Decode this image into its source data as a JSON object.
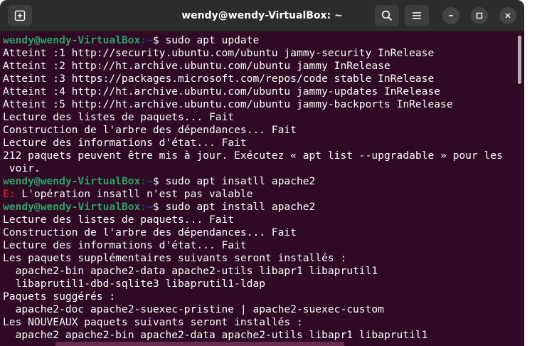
{
  "window": {
    "title": "wendy@wendy-VirtualBox: ~"
  },
  "prompt": {
    "user_host": "wendy@wendy-VirtualBox",
    "separator": ":",
    "path": "~",
    "symbol": "$ "
  },
  "lines": [
    {
      "type": "cmd",
      "text": "sudo apt update"
    },
    {
      "type": "out",
      "text": "Atteint :1 http://security.ubuntu.com/ubuntu jammy-security InRelease"
    },
    {
      "type": "out",
      "text": "Atteint :2 http://ht.archive.ubuntu.com/ubuntu jammy InRelease"
    },
    {
      "type": "out",
      "text": "Atteint :3 https://packages.microsoft.com/repos/code stable InRelease"
    },
    {
      "type": "out",
      "text": "Atteint :4 http://ht.archive.ubuntu.com/ubuntu jammy-updates InRelease"
    },
    {
      "type": "out",
      "text": "Atteint :5 http://ht.archive.ubuntu.com/ubuntu jammy-backports InRelease"
    },
    {
      "type": "out",
      "text": "Lecture des listes de paquets... Fait"
    },
    {
      "type": "out",
      "text": "Construction de l'arbre des dépendances... Fait"
    },
    {
      "type": "out",
      "text": "Lecture des informations d'état... Fait"
    },
    {
      "type": "out",
      "text": "212 paquets peuvent être mis à jour. Exécutez « apt list --upgradable » pour les"
    },
    {
      "type": "out",
      "text": " voir."
    },
    {
      "type": "cmd",
      "text": "sudo apt insatll apache2"
    },
    {
      "type": "err",
      "prefix": "E:",
      "text": " L'opération insatll n'est pas valable"
    },
    {
      "type": "cmd",
      "text": "sudo apt install apache2"
    },
    {
      "type": "out",
      "text": "Lecture des listes de paquets... Fait"
    },
    {
      "type": "out",
      "text": "Construction de l'arbre des dépendances... Fait"
    },
    {
      "type": "out",
      "text": "Lecture des informations d'état... Fait"
    },
    {
      "type": "out",
      "text": "Les paquets supplémentaires suivants seront installés :"
    },
    {
      "type": "out",
      "text": "  apache2-bin apache2-data apache2-utils libapr1 libaprutil1"
    },
    {
      "type": "out",
      "text": "  libaprutil1-dbd-sqlite3 libaprutil1-ldap"
    },
    {
      "type": "out",
      "text": "Paquets suggérés :"
    },
    {
      "type": "out",
      "text": "  apache2-doc apache2-suexec-pristine | apache2-suexec-custom"
    },
    {
      "type": "out",
      "text": "Les NOUVEAUX paquets suivants seront installés :"
    },
    {
      "type": "out",
      "text": "  apache2 apache2-bin apache2-data apache2-utils libapr1 libaprutil1"
    }
  ],
  "colors": {
    "terminal_bg": "#300a24",
    "titlebar_bg": "#2c2c2c",
    "prompt_user": "#26a269",
    "prompt_path": "#12488b",
    "error": "#c01c28",
    "text": "#ffffff"
  },
  "icons": {
    "new_tab": "new-tab-icon",
    "search": "search-icon",
    "menu": "hamburger-menu-icon",
    "minimize": "minimize-icon",
    "maximize": "maximize-icon",
    "close": "close-icon"
  }
}
